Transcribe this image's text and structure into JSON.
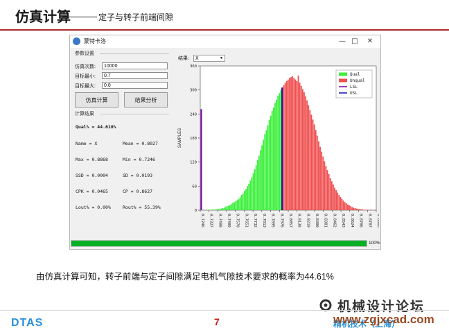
{
  "slide": {
    "title": "仿真计算",
    "subtitle": "定子与转子前端间隙",
    "conclusion": "由仿真计算可知，转子前端与定子间隙满足电机气隙技术要求的概率为44.61%",
    "page_number": "7",
    "footer_logo": "DTAS",
    "footer_right": "精机技术（上海）",
    "watermark_title": "机械设计论坛",
    "watermark_url": "www.zgjxcad.com"
  },
  "window": {
    "title": "蒙特卡洛",
    "min_icon": "minimize-icon",
    "max_icon": "maximize-icon",
    "close_icon": "close-icon"
  },
  "params": {
    "group_label": "参数设置",
    "fields": [
      {
        "label": "仿真次数:",
        "value": "10000"
      },
      {
        "label": "目标最小:",
        "value": "0.7"
      },
      {
        "label": "目标最大:",
        "value": "0.8"
      }
    ],
    "simulate_button": "仿真计算",
    "analyze_button": "结果分析"
  },
  "results": {
    "group_label": "计算结果",
    "qual": "Qual% = 44.610%",
    "rows": [
      [
        "Name  = X",
        "Mean  = 0.8027"
      ],
      [
        "Max   = 0.8868",
        "Min   = 0.7246"
      ],
      [
        "SSD   = 0.0004",
        "SD    = 0.0193"
      ],
      [
        "CPK   = 0.0465",
        "CP    = 0.8627"
      ],
      [
        "Lout% = 0.00%",
        "Rout% = 55.39%"
      ]
    ]
  },
  "result_selector": {
    "label": "结果:",
    "value": "X"
  },
  "progress": {
    "value": 1.0,
    "label": "100%"
  },
  "chart_data": {
    "type": "bar",
    "ylabel": "SAMPLES",
    "ylim": [
      0,
      360
    ],
    "yticks": [
      0,
      60,
      120,
      180,
      240,
      300,
      360
    ],
    "xlim": [
      0.7246,
      0.8868
    ],
    "xticks": [
      "0.7246",
      "0.7327",
      "0.7408",
      "0.7489",
      "0.7570",
      "0.7651",
      "0.7732",
      "0.7813",
      "0.7895",
      "0.7976",
      "0.8057",
      "0.8138",
      "0.8219",
      "0.8300",
      "0.8381",
      "0.8462",
      "0.8543",
      "0.8624",
      "0.8706",
      "0.8787",
      "0.8868"
    ],
    "legend": [
      "Qual",
      "Unqual",
      "LSL",
      "USL"
    ],
    "legend_position": "top-right",
    "colors": {
      "qual": "#3cf03c",
      "unqual": "#f05050",
      "lsl": "#7a00b0",
      "usl": "#1010b0"
    },
    "lsl": 0.7246,
    "usl": 0.8,
    "lsl_line_top": 252,
    "bin_width": 0.0013,
    "counts": [
      1,
      0,
      0,
      1,
      0,
      1,
      1,
      1,
      2,
      1,
      2,
      2,
      3,
      3,
      4,
      5,
      6,
      8,
      10,
      11,
      13,
      15,
      18,
      20,
      23,
      25,
      28,
      32,
      38,
      42,
      48,
      52,
      60,
      66,
      74,
      82,
      92,
      102,
      112,
      125,
      136,
      150,
      162,
      176,
      190,
      200,
      212,
      225,
      236,
      248,
      256,
      268,
      276,
      286,
      292,
      300,
      306,
      312,
      318,
      322,
      326,
      330,
      332,
      334,
      330,
      326,
      322,
      336,
      318,
      310,
      302,
      294,
      284,
      274,
      262,
      250,
      238,
      226,
      214,
      200,
      186,
      172,
      158,
      146,
      134,
      122,
      110,
      100,
      90,
      80,
      72,
      64,
      56,
      50,
      44,
      38,
      33,
      28,
      24,
      20,
      17,
      14,
      12,
      10,
      8,
      6,
      5,
      4,
      3,
      3,
      2,
      2,
      1,
      1,
      1,
      1,
      0,
      1,
      0,
      0,
      1
    ]
  }
}
